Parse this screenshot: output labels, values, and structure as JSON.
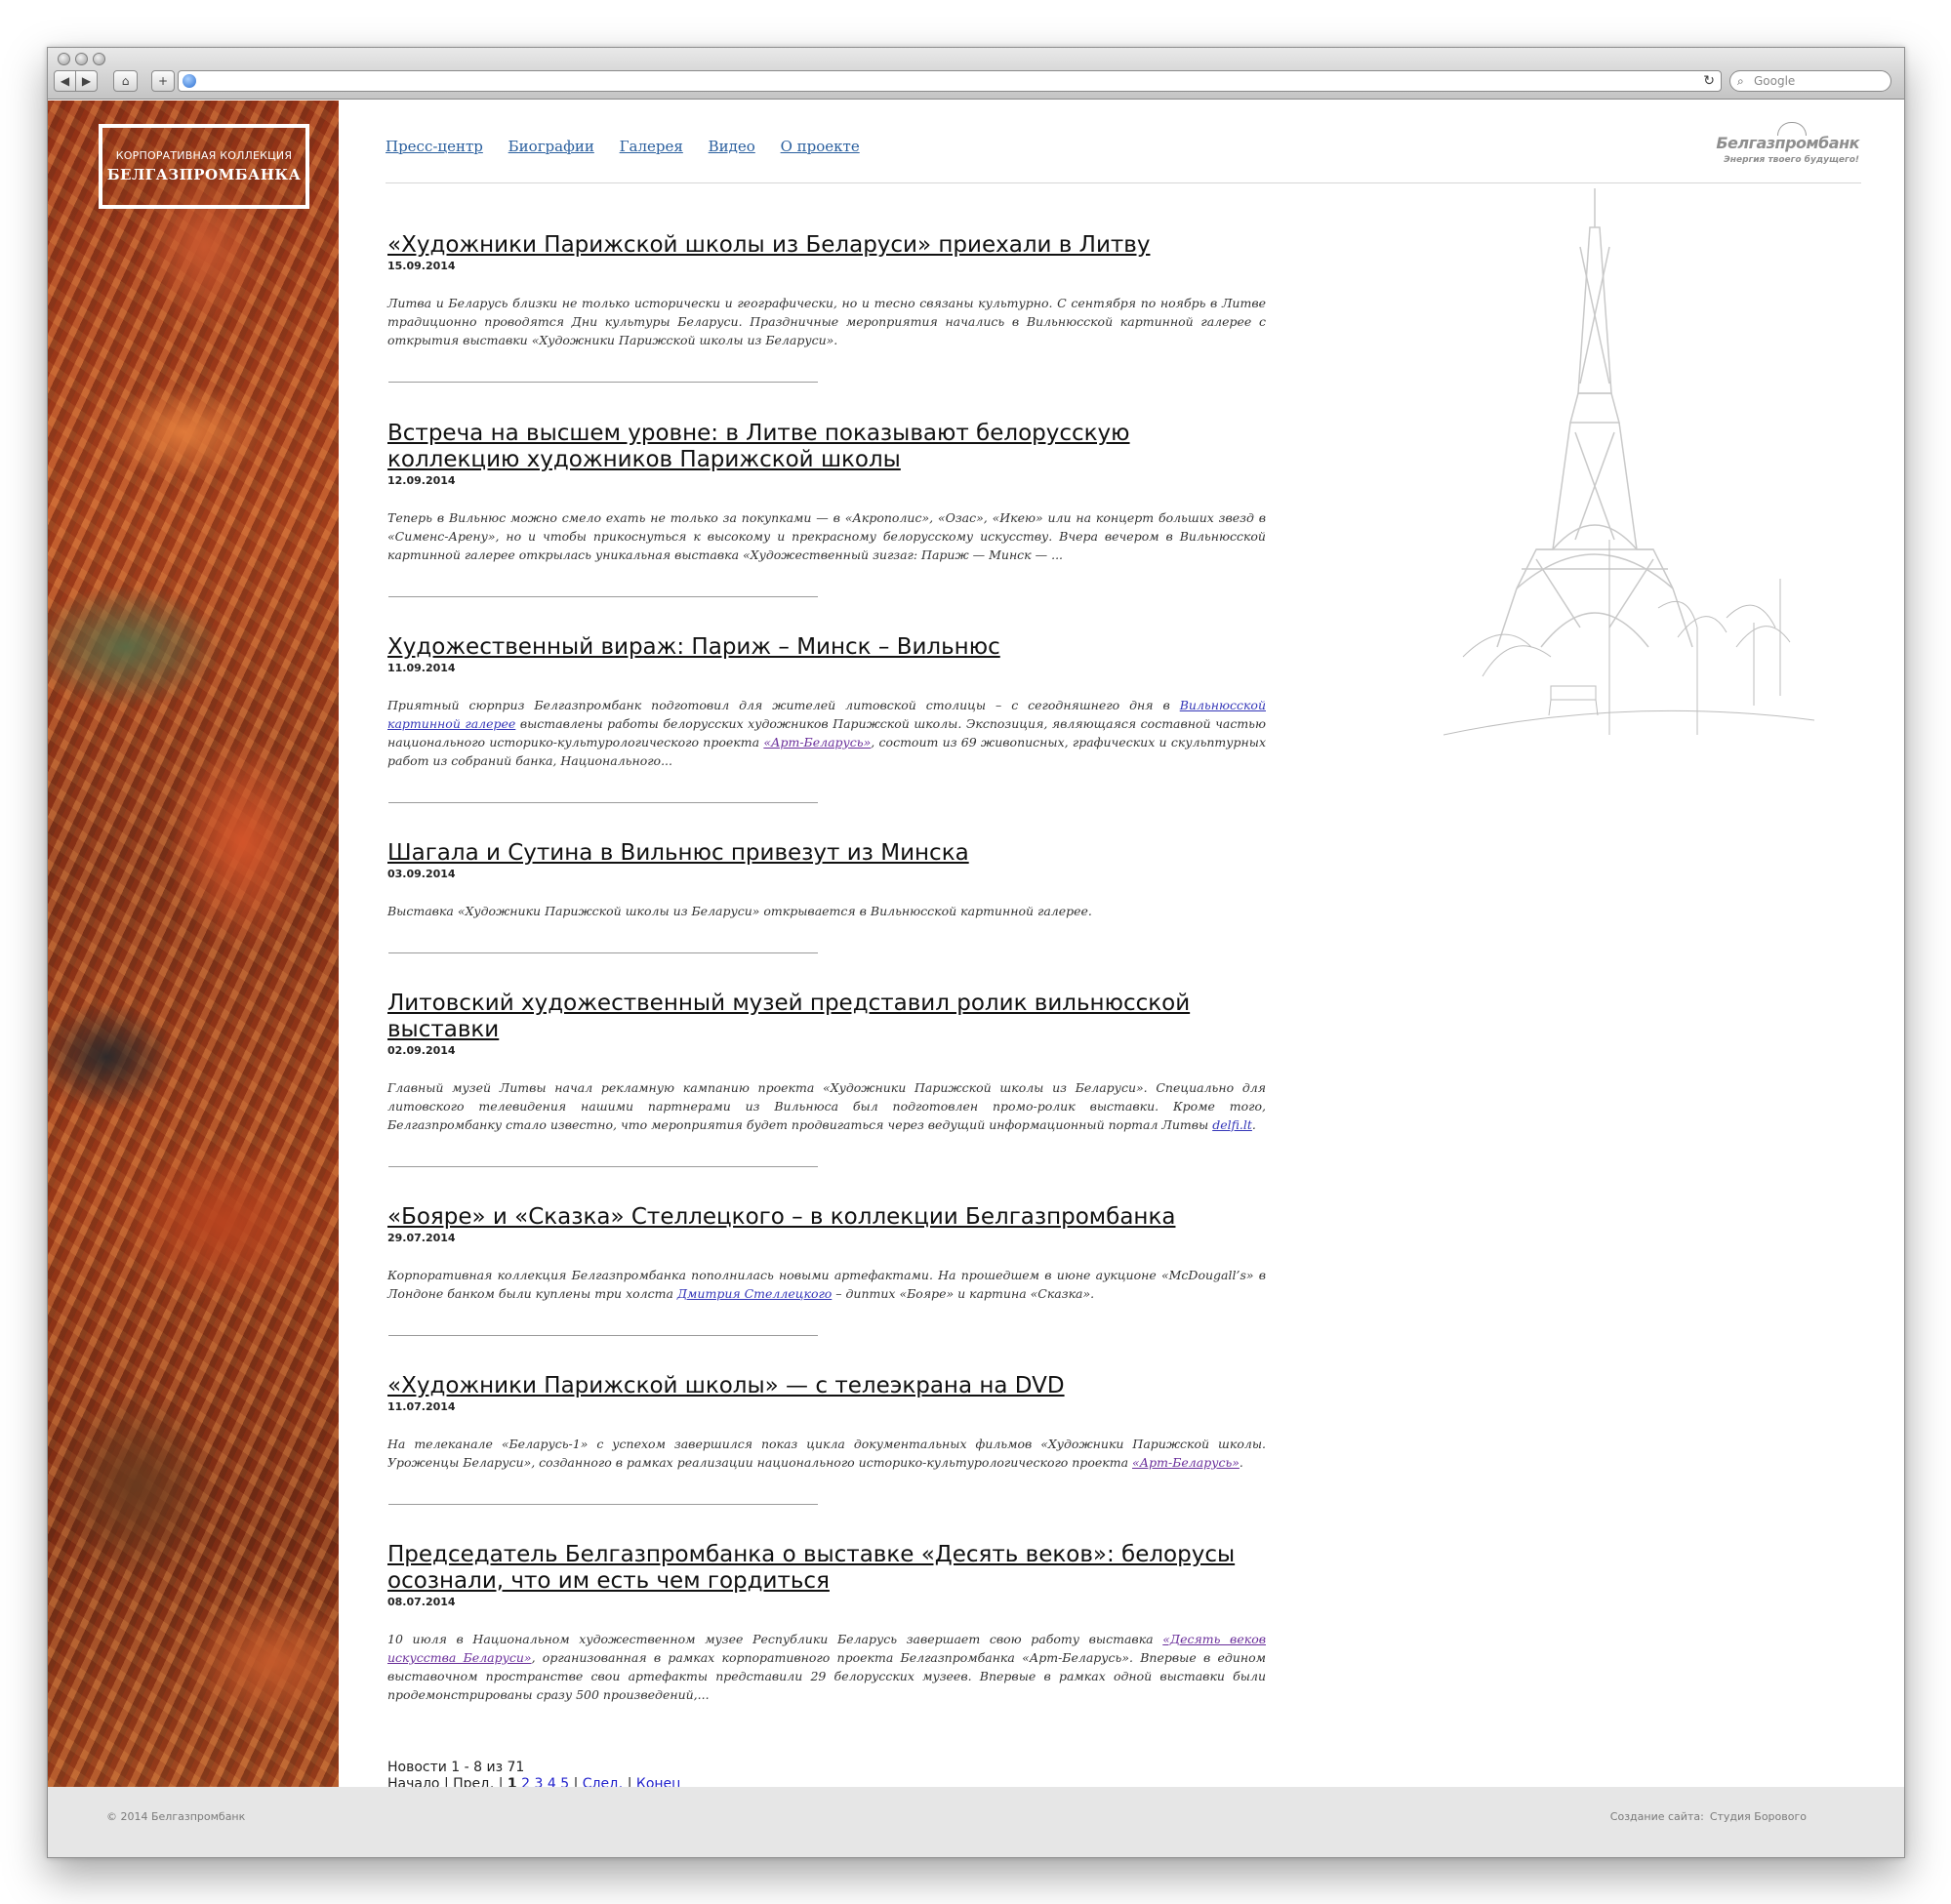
{
  "browser": {
    "search_placeholder": "Google",
    "reload_glyph": "↻",
    "add_glyph": "+",
    "home_glyph": "⌂",
    "back_glyph": "◀",
    "forward_glyph": "▶",
    "search_glyph": "⌕"
  },
  "site_logo": {
    "line1": "КОРПОРАТИВНАЯ КОЛЛЕКЦИЯ",
    "line2": "БЕЛГАЗПРОМБАНКА"
  },
  "nav": {
    "items": [
      {
        "label": "Пресс-центр"
      },
      {
        "label": "Биографии"
      },
      {
        "label": "Галерея"
      },
      {
        "label": "Видео"
      },
      {
        "label": "О проекте"
      }
    ]
  },
  "bank_logo": {
    "name": "Белгазпромбанк",
    "slogan": "Энергия твоего будущего!"
  },
  "news": [
    {
      "title": "«Художники Парижской школы из Беларуси» приехали в Литву",
      "date": "15.09.2014",
      "text": "Литва и Беларусь близки не только исторически и географически, но и тесно связаны культурно. С сентября по ноябрь в Литве традиционно проводятся Дни культуры Беларуси. Праздничные мероприятия начались в Вильнюсской картинной галерее с открытия выставки «Художники Парижской школы из Беларуси»."
    },
    {
      "title": "Встреча на высшем уровне: в Литве показывают белорусскую коллекцию художников Парижской школы",
      "date": "12.09.2014",
      "text": "Теперь в Вильнюс можно смело ехать не только за покупками — в «Акрополис», «Озас», «Икею» или на концерт больших звезд в «Сименс-Арену», но и чтобы прикоснуться к высокому и прекрасному белорусскому искусству. Вчера вечером в Вильнюсской картинной галерее открылась уникальная выставка «Художественный зигзаг: Париж — Минск — ..."
    },
    {
      "title": "Художественный вираж: Париж – Минск – Вильнюс",
      "date": "11.09.2014",
      "text_1": "Приятный сюрприз Белгазпромбанк подготовил для жителей литовской столицы – с сегодняшнего дня в ",
      "link_1": "Вильнюсской картинной галерее",
      "text_2": " выставлены работы белорусских художников Парижской школы. Экспозиция, являющаяся составной частью национального историко-культурологического проекта ",
      "link_2": "«Арт-Беларусь»",
      "text_3": ", состоит из 69 живописных, графических и скульптурных работ из собраний банка, Национального..."
    },
    {
      "title": "Шагала и Сутина в Вильнюс привезут из Минска",
      "date": "03.09.2014",
      "text": "Выставка «Художники Парижской школы из Беларуси» открывается в Вильнюсской картинной галерее."
    },
    {
      "title": "Литовский художественный музей представил ролик вильнюсской выставки",
      "date": "02.09.2014",
      "text_1": "Главный музей Литвы начал рекламную кампанию проекта «Художники Парижской школы из Беларуси». Специально для литовского телевидения нашими партнерами из Вильнюса был подготовлен промо-ролик выставки. Кроме того, Белгазпромбанку стало известно, что мероприятия будет продвигаться через ведущий информационный портал Литвы ",
      "link_1": "delfi.lt",
      "text_2": "."
    },
    {
      "title": "«Бояре» и «Сказка» Стеллецкого – в коллекции Белгазпромбанка",
      "date": "29.07.2014",
      "text_1": "Корпоративная коллекция Белгазпромбанка пополнилась новыми артефактами. На прошедшем в июне аукционе «McDougall’s» в Лондоне банком были куплены три холста ",
      "link_1": "Дмитрия Стеллецкого",
      "text_2": " – диптих «Бояре» и картина «Сказка»."
    },
    {
      "title": "«Художники Парижской школы» — с телеэкрана на DVD",
      "date": "11.07.2014",
      "text_1": "На телеканале «Беларусь-1» с успехом завершился показ цикла документальных фильмов «Художники Парижской школы. Уроженцы Беларуси», созданного в рамках реализации национального историко-культурологического проекта ",
      "link_1": "«Арт-Беларусь»",
      "text_2": "."
    },
    {
      "title": "Председатель Белгазпромбанка о выставке «Десять веков»: белорусы осознали, что им есть чем гордиться",
      "date": "08.07.2014",
      "text_1": "10 июля в Национальном художественном музее Республики Беларусь завершает свою работу выставка ",
      "link_1": "«Десять веков искусства Беларуси»",
      "text_2": ", организованная в рамках корпоративного проекта Белгазпромбанка «Арт-Беларусь». Впервые в едином выставочном пространстве свои артефакты представили 29 белорусских музеев. Впервые в рамках одной выставки были продемонстрированы сразу 500 произведений,..."
    }
  ],
  "pager": {
    "summary": "Новости 1 - 8 из 71",
    "first": "Начало",
    "prev": "Пред.",
    "current": "1",
    "pages": [
      "2",
      "3",
      "4",
      "5"
    ],
    "next": "След.",
    "last": "Конец",
    "sep": "|"
  },
  "footer": {
    "copyright": "© 2014 Белгазпромбанк",
    "credit_label": "Создание сайта:",
    "credit_link": "Студия Борового"
  }
}
